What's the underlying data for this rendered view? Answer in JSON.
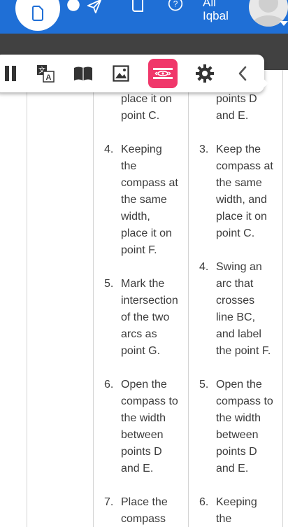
{
  "header": {
    "user_name_line1": "Ali",
    "user_name_line2": "Iqbal",
    "icons": [
      "home-icon",
      "send-icon",
      "notebook-icon",
      "help-icon",
      "avatar"
    ],
    "bg_color": "#1f6fd6"
  },
  "toolbar": {
    "buttons": [
      "pause-icon",
      "translate-icon",
      "book-icon",
      "image-icon",
      "reading-mode-icon",
      "settings-icon",
      "back-chevron-icon"
    ],
    "active_color": "#f0376a"
  },
  "columns": {
    "left": {
      "partial_top": [
        "place it on",
        "point C."
      ],
      "items": [
        {
          "num": "4.",
          "lines": [
            "Keeping",
            "the",
            "compass at",
            "the same",
            "width,",
            "place it on",
            "point F."
          ]
        },
        {
          "num": "5.",
          "lines": [
            "Mark the",
            "intersection",
            "of the two",
            "arcs as",
            "point G."
          ]
        },
        {
          "num": "6.",
          "lines": [
            "Open the",
            "compass to",
            "the width",
            "between",
            "points D",
            "and E."
          ]
        },
        {
          "num": "7.",
          "lines": [
            "Place the",
            "compass"
          ]
        }
      ]
    },
    "right": {
      "partial_top": [
        "points D",
        "and E."
      ],
      "items": [
        {
          "num": "3.",
          "lines": [
            "Keep the",
            "compass at",
            "the same",
            "width, and",
            "place it on",
            "point C."
          ]
        },
        {
          "num": "4.",
          "lines": [
            "Swing an",
            "arc that",
            "crosses",
            "line BC,",
            "and label",
            "the point F."
          ]
        },
        {
          "num": "5.",
          "lines": [
            "Open the",
            "compass to",
            "the width",
            "between",
            "points D",
            "and E."
          ]
        },
        {
          "num": "6.",
          "lines": [
            "Keeping",
            "the"
          ]
        }
      ]
    }
  }
}
